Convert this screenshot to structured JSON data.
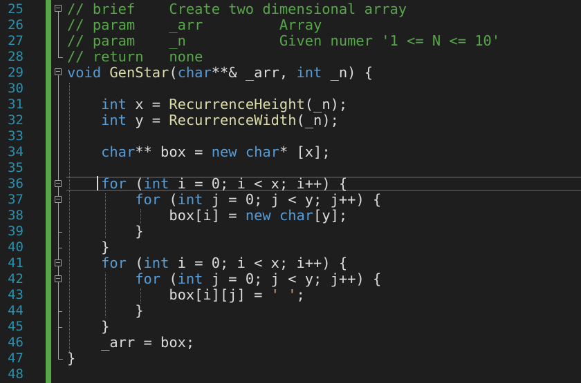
{
  "editor": {
    "colors": {
      "background": "#1e1e1e",
      "line_number": "#2b91af",
      "comment": "#57a64a",
      "keyword": "#569cd6",
      "function": "#dcdcaa",
      "identifier": "#dcdcdc",
      "string": "#d69d85",
      "change_bar": "#57a64a"
    },
    "lines": [
      {
        "n": "25",
        "tokens": [
          {
            "t": "// brief    Create two dimensional array",
            "c": "comment"
          }
        ]
      },
      {
        "n": "26",
        "tokens": [
          {
            "t": "// param    _arr         Array",
            "c": "comment"
          }
        ]
      },
      {
        "n": "27",
        "tokens": [
          {
            "t": "// param    _n           Given numer '1 <= N <= 10'",
            "c": "comment"
          }
        ]
      },
      {
        "n": "28",
        "tokens": [
          {
            "t": "// return   none",
            "c": "comment"
          }
        ]
      },
      {
        "n": "29",
        "tokens": [
          {
            "t": "void",
            "c": "keyword"
          },
          {
            "t": " ",
            "c": "ident"
          },
          {
            "t": "GenStar",
            "c": "function"
          },
          {
            "t": "(",
            "c": "ident"
          },
          {
            "t": "char",
            "c": "keyword"
          },
          {
            "t": "**& _arr, ",
            "c": "ident"
          },
          {
            "t": "int",
            "c": "keyword"
          },
          {
            "t": " _n) {",
            "c": "ident"
          }
        ]
      },
      {
        "n": "30",
        "tokens": []
      },
      {
        "n": "31",
        "tokens": [
          {
            "t": "    ",
            "c": "ident"
          },
          {
            "t": "int",
            "c": "keyword"
          },
          {
            "t": " x = ",
            "c": "ident"
          },
          {
            "t": "RecurrenceHeight",
            "c": "function"
          },
          {
            "t": "(_n);",
            "c": "ident"
          }
        ]
      },
      {
        "n": "32",
        "tokens": [
          {
            "t": "    ",
            "c": "ident"
          },
          {
            "t": "int",
            "c": "keyword"
          },
          {
            "t": " y = ",
            "c": "ident"
          },
          {
            "t": "RecurrenceWidth",
            "c": "function"
          },
          {
            "t": "(_n);",
            "c": "ident"
          }
        ]
      },
      {
        "n": "33",
        "tokens": []
      },
      {
        "n": "34",
        "tokens": [
          {
            "t": "    ",
            "c": "ident"
          },
          {
            "t": "char",
            "c": "keyword"
          },
          {
            "t": "** box = ",
            "c": "ident"
          },
          {
            "t": "new",
            "c": "keyword"
          },
          {
            "t": " ",
            "c": "ident"
          },
          {
            "t": "char",
            "c": "keyword"
          },
          {
            "t": "* [x];",
            "c": "ident"
          }
        ]
      },
      {
        "n": "35",
        "tokens": []
      },
      {
        "n": "36",
        "tokens": [
          {
            "t": "    ",
            "c": "ident"
          },
          {
            "t": "for",
            "c": "keyword"
          },
          {
            "t": " (",
            "c": "ident"
          },
          {
            "t": "int",
            "c": "keyword"
          },
          {
            "t": " i = 0; i < x; i++) {",
            "c": "ident"
          }
        ]
      },
      {
        "n": "37",
        "tokens": [
          {
            "t": "        ",
            "c": "ident"
          },
          {
            "t": "for",
            "c": "keyword"
          },
          {
            "t": " (",
            "c": "ident"
          },
          {
            "t": "int",
            "c": "keyword"
          },
          {
            "t": " j = 0; j < y; j++) {",
            "c": "ident"
          }
        ]
      },
      {
        "n": "38",
        "tokens": [
          {
            "t": "            box[i] = ",
            "c": "ident"
          },
          {
            "t": "new",
            "c": "keyword"
          },
          {
            "t": " ",
            "c": "ident"
          },
          {
            "t": "char",
            "c": "keyword"
          },
          {
            "t": "[y];",
            "c": "ident"
          }
        ]
      },
      {
        "n": "39",
        "tokens": [
          {
            "t": "        }",
            "c": "ident"
          }
        ]
      },
      {
        "n": "40",
        "tokens": [
          {
            "t": "    }",
            "c": "ident"
          }
        ]
      },
      {
        "n": "41",
        "tokens": [
          {
            "t": "    ",
            "c": "ident"
          },
          {
            "t": "for",
            "c": "keyword"
          },
          {
            "t": " (",
            "c": "ident"
          },
          {
            "t": "int",
            "c": "keyword"
          },
          {
            "t": " i = 0; i < x; i++) {",
            "c": "ident"
          }
        ]
      },
      {
        "n": "42",
        "tokens": [
          {
            "t": "        ",
            "c": "ident"
          },
          {
            "t": "for",
            "c": "keyword"
          },
          {
            "t": " (",
            "c": "ident"
          },
          {
            "t": "int",
            "c": "keyword"
          },
          {
            "t": " j = 0; j < y; j++) {",
            "c": "ident"
          }
        ]
      },
      {
        "n": "43",
        "tokens": [
          {
            "t": "            box[i][j] = ",
            "c": "ident"
          },
          {
            "t": "' '",
            "c": "string"
          },
          {
            "t": ";",
            "c": "ident"
          }
        ]
      },
      {
        "n": "44",
        "tokens": [
          {
            "t": "        }",
            "c": "ident"
          }
        ]
      },
      {
        "n": "45",
        "tokens": [
          {
            "t": "    }",
            "c": "ident"
          }
        ]
      },
      {
        "n": "46",
        "tokens": [
          {
            "t": "    _arr = box;",
            "c": "ident"
          }
        ]
      },
      {
        "n": "47",
        "tokens": [
          {
            "t": "}",
            "c": "ident"
          }
        ]
      },
      {
        "n": "48",
        "tokens": []
      }
    ]
  }
}
